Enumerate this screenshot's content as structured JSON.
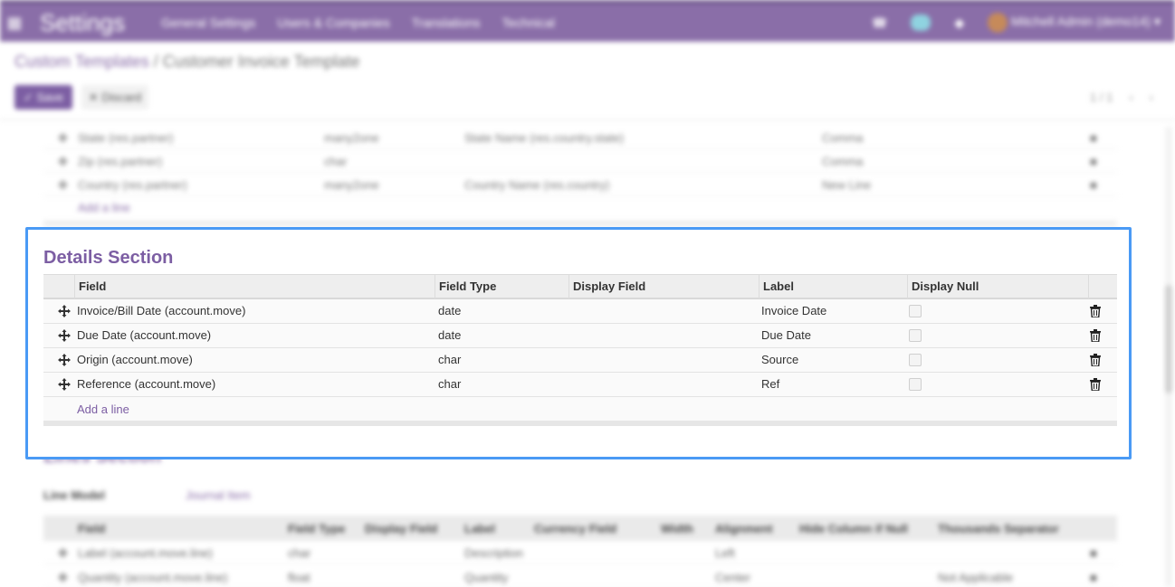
{
  "navbar": {
    "brand": "Settings",
    "menu": [
      "General Settings",
      "Users & Companies",
      "Translations",
      "Technical"
    ],
    "user": "Mitchell Admin (demo14)"
  },
  "breadcrumb": {
    "parent": "Custom Templates",
    "separator": " / ",
    "current": "Customer Invoice Template"
  },
  "toolbar": {
    "save_label": "Save",
    "discard_label": "Discard",
    "pager": "1 / 1"
  },
  "address_rows": [
    {
      "field": "State (res.partner)",
      "type": "many2one",
      "display": "State Name (res.country.state)",
      "label": "Comma"
    },
    {
      "field": "Zip (res.partner)",
      "type": "char",
      "display": "",
      "label": "Comma"
    },
    {
      "field": "Country (res.partner)",
      "type": "many2one",
      "display": "Country Name (res.country)",
      "label": "New Line"
    }
  ],
  "address_add_line": "Add a line",
  "details": {
    "title": "Details Section",
    "headers": {
      "field": "Field",
      "field_type": "Field Type",
      "display_field": "Display Field",
      "label": "Label",
      "display_null": "Display Null"
    },
    "rows": [
      {
        "field": "Invoice/Bill Date (account.move)",
        "field_type": "date",
        "display_field": "",
        "label": "Invoice Date",
        "display_null": false
      },
      {
        "field": "Due Date (account.move)",
        "field_type": "date",
        "display_field": "",
        "label": "Due Date",
        "display_null": false
      },
      {
        "field": "Origin (account.move)",
        "field_type": "char",
        "display_field": "",
        "label": "Source",
        "display_null": false
      },
      {
        "field": "Reference (account.move)",
        "field_type": "char",
        "display_field": "",
        "label": "Ref",
        "display_null": false
      }
    ],
    "add_line": "Add a line"
  },
  "lines": {
    "title": "Lines Section",
    "model_label": "Line Model",
    "model_value": "Journal Item",
    "headers": [
      "Field",
      "Field Type",
      "Display Field",
      "Label",
      "Currency Field",
      "Width",
      "Alignment",
      "Hide Column if Null",
      "Thousands Separator"
    ],
    "rows": [
      {
        "field": "Label (account.move.line)",
        "type": "char",
        "label": "Description",
        "align": "Left",
        "sep": ""
      },
      {
        "field": "Quantity (account.move.line)",
        "type": "float",
        "label": "Quantity",
        "align": "Center",
        "sep": "Not Applicable"
      }
    ]
  },
  "colors": {
    "brand": "#8a6ea8",
    "accent": "#7c5ea3",
    "focus": "#4a9af5"
  }
}
